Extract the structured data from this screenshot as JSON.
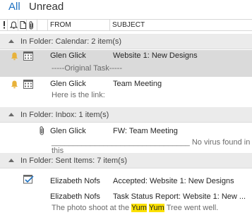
{
  "tabs": {
    "all": "All",
    "unread": "Unread"
  },
  "columns": {
    "icons": [
      "importance-icon",
      "reminder-bell-icon",
      "document-icon",
      "attachment-icon"
    ],
    "from": "FROM",
    "subject": "SUBJECT"
  },
  "groups": [
    {
      "label": "In Folder: Calendar: 2 item(s)",
      "rows": [
        {
          "from": "Glen Glick",
          "subject": "Website 1: New Designs",
          "preview": "-----Original Task-----",
          "icons": [
            "reminder-bell-icon",
            "calendar-icon"
          ],
          "selected": true
        },
        {
          "from": "Glen Glick",
          "subject": "Team Meeting",
          "preview": "Here is the link:",
          "icons": [
            "reminder-bell-icon",
            "calendar-icon"
          ],
          "selected": false
        }
      ]
    },
    {
      "label": "In Folder: Inbox: 1 item(s)",
      "rows": [
        {
          "from": "Glen Glick",
          "subject": "FW: Team Meeting",
          "preview": "________________________________ No virus found in this",
          "icons": [
            "attachment-icon"
          ],
          "selected": false
        }
      ]
    },
    {
      "label": "In Folder: Sent Items: 7 item(s)",
      "rows": [
        {
          "from": "Elizabeth Nofs",
          "subject": "Accepted: Website 1: New Designs",
          "icons": [
            "task-accepted-icon"
          ],
          "selected": false
        },
        {
          "from": "Elizabeth Nofs",
          "subject": "Task Status Report: Website 1: New ...",
          "preview_before": "The photo shoot at the ",
          "preview_hl1": "Yum",
          "preview_between": " ",
          "preview_hl2": "Yum",
          "preview_after": " Tree went well.",
          "icons": [],
          "selected": false
        }
      ]
    }
  ],
  "colors": {
    "accent": "#1d71c1",
    "bell": "#e8b23a",
    "highlight": "#fce100",
    "group_bg": "#ebebeb",
    "selected_bg": "#dadada"
  }
}
